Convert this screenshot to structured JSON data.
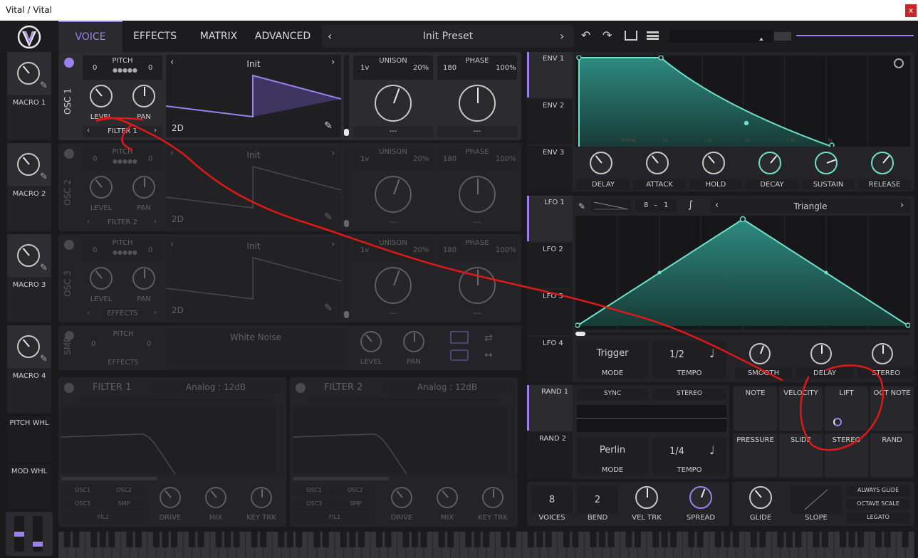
{
  "window": {
    "title": "Vital / Vital",
    "close": "x"
  },
  "topbar": {
    "tabs": [
      "VOICE",
      "EFFECTS",
      "MATRIX",
      "ADVANCED"
    ],
    "preset": "Init Preset"
  },
  "macros": [
    "MACRO 1",
    "MACRO 2",
    "MACRO 3",
    "MACRO 4"
  ],
  "wheels": {
    "pitch": "PITCH WHL",
    "mod": "MOD WHL"
  },
  "osc": [
    {
      "label": "OSC 1",
      "pitch_label": "PITCH",
      "pitch_l": "0",
      "pitch_r": "0",
      "level": "LEVEL",
      "pan": "PAN",
      "dest": "FILTER 1",
      "wavetable": "Init",
      "dim": "2D",
      "unison_v": "1v",
      "unison_label": "UNISON",
      "unison_pct": "20%",
      "phase_v": "180",
      "phase_label": "PHASE",
      "phase_pct": "100%",
      "sel1": "---",
      "sel2": "---"
    },
    {
      "label": "OSC 2",
      "pitch_label": "PITCH",
      "pitch_l": "0",
      "pitch_r": "0",
      "level": "LEVEL",
      "pan": "PAN",
      "dest": "FILTER 2",
      "wavetable": "Init",
      "dim": "2D",
      "unison_v": "1v",
      "unison_label": "UNISON",
      "unison_pct": "20%",
      "phase_v": "180",
      "phase_label": "PHASE",
      "phase_pct": "100%",
      "sel1": "---",
      "sel2": "---"
    },
    {
      "label": "OSC 3",
      "pitch_label": "PITCH",
      "pitch_l": "0",
      "pitch_r": "0",
      "level": "LEVEL",
      "pan": "PAN",
      "dest": "EFFECTS",
      "wavetable": "Init",
      "dim": "2D",
      "unison_v": "1v",
      "unison_label": "UNISON",
      "unison_pct": "20%",
      "phase_v": "180",
      "phase_label": "PHASE",
      "phase_pct": "100%",
      "sel1": "---",
      "sel2": "---"
    }
  ],
  "smp": {
    "label": "SMP",
    "pitch_label": "PITCH",
    "pitch_l": "0",
    "pitch_r": "0",
    "dest": "EFFECTS",
    "sample": "White Noise",
    "level": "LEVEL",
    "pan": "PAN"
  },
  "filters": [
    {
      "title": "FILTER 1",
      "model": "Analog : 12dB",
      "routes": [
        "OSC1",
        "OSC2",
        "OSC3",
        "SMP",
        "FIL2"
      ],
      "drive": "DRIVE",
      "mix": "MIX",
      "keytrk": "KEY TRK"
    },
    {
      "title": "FILTER 2",
      "model": "Analog : 12dB",
      "routes": [
        "OSC1",
        "OSC2",
        "OSC3",
        "SMP",
        "FIL1"
      ],
      "drive": "DRIVE",
      "mix": "MIX",
      "keytrk": "KEY TRK"
    }
  ],
  "env": {
    "tabs": [
      "ENV 1",
      "ENV 2",
      "ENV 3"
    ],
    "knobs": [
      "DELAY",
      "ATTACK",
      "HOLD",
      "DECAY",
      "SUSTAIN",
      "RELEASE"
    ],
    "time_marks": [
      "500ms",
      "1s",
      "1.5s",
      "2s",
      "2.5s",
      "3s"
    ]
  },
  "lfo": {
    "tabs": [
      "LFO 1",
      "LFO 2",
      "LFO 3",
      "LFO 4"
    ],
    "grid_a": "8",
    "grid_b": "1",
    "shape": "Triangle",
    "mode_value": "Trigger",
    "mode_label": "MODE",
    "tempo_value": "1/2",
    "tempo_label": "TEMPO",
    "knobs": [
      "SMOOTH",
      "DELAY",
      "STEREO"
    ]
  },
  "rand": {
    "tabs": [
      "RAND 1",
      "RAND 2"
    ],
    "sync": "SYNC",
    "stereo": "STEREO",
    "style": "Perlin",
    "mode_label": "MODE",
    "tempo_value": "1/4",
    "tempo_label": "TEMPO"
  },
  "mods": {
    "row1": [
      "NOTE",
      "VELOCITY",
      "LIFT",
      "OCT NOTE"
    ],
    "row2": [
      "PRESSURE",
      "SLIDE",
      "STEREO",
      "RAND"
    ]
  },
  "voice": {
    "voices": "8",
    "voices_label": "VOICES",
    "bend": "2",
    "bend_label": "BEND",
    "veltrk": "VEL TRK",
    "spread": "SPREAD",
    "glide": "GLIDE",
    "slope": "SLOPE",
    "always_glide": "ALWAYS GLIDE",
    "octave_scale": "OCTAVE SCALE",
    "legato": "LEGATO"
  },
  "colors": {
    "accent": "#9d80f0",
    "env": "#6fe0c8",
    "annotation": "#e01818"
  }
}
